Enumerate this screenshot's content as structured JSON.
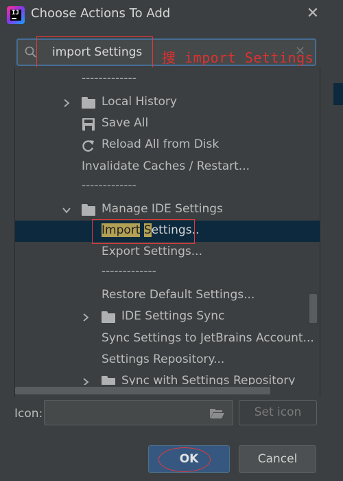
{
  "window": {
    "title": "Choose Actions To Add",
    "app_logo": "intellij-logo",
    "close_icon": "close-icon"
  },
  "search": {
    "value": "import Settings",
    "annotation": "搜 import Settings"
  },
  "tree": {
    "rows": [
      {
        "label": "-------------",
        "type": "separator"
      },
      {
        "label": "Local History",
        "type": "group",
        "expanded": false,
        "icon": "folder-icon"
      },
      {
        "label": "Save All",
        "type": "action",
        "icon": "save-icon"
      },
      {
        "label": "Reload All from Disk",
        "type": "action",
        "icon": "reload-icon"
      },
      {
        "label": "Invalidate Caches / Restart...",
        "type": "action"
      },
      {
        "label": "-------------",
        "type": "separator"
      },
      {
        "label": "Manage IDE Settings",
        "type": "group",
        "expanded": true,
        "icon": "folder-icon"
      },
      {
        "label_parts": [
          "Import",
          " ",
          "S",
          "ettings.."
        ],
        "type": "action",
        "selected": true
      },
      {
        "label": "Export Settings...",
        "type": "action"
      },
      {
        "label": "-------------",
        "type": "separator"
      },
      {
        "label": "Restore Default Settings...",
        "type": "action"
      },
      {
        "label": "IDE Settings Sync",
        "type": "group",
        "expanded": false,
        "icon": "folder-icon"
      },
      {
        "label": "Sync Settings to JetBrains Account...",
        "type": "action"
      },
      {
        "label": "Settings Repository...",
        "type": "action"
      },
      {
        "label": "Sync with Settings Repository",
        "type": "group",
        "expanded": false,
        "icon": "folder-icon"
      }
    ]
  },
  "icon_row": {
    "label": "Icon:",
    "path_value": "",
    "set_icon_label": "Set icon"
  },
  "buttons": {
    "ok": "OK",
    "cancel": "Cancel"
  },
  "colors": {
    "background": "#3c3f41",
    "selection": "#0d293e",
    "match_highlight": "#b2a055",
    "annotation_red": "#e03030",
    "ok_button": "#365880"
  }
}
